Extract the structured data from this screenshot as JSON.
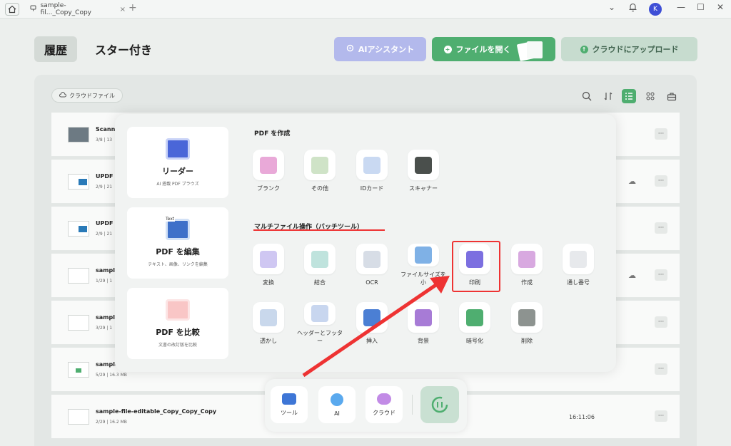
{
  "titlebar": {
    "tab_title": "sample-fil..._Copy_Copy",
    "avatar_letter": "K",
    "plus": "+",
    "close": "×",
    "minimize": "—",
    "maximize": "☐",
    "window_close": "✕",
    "chevron": "⌄",
    "bell": "🔔"
  },
  "nav": {
    "history": "履歴",
    "starred": "スター付き"
  },
  "header_buttons": {
    "ai": "AIアシスタント",
    "open": "ファイルを開く",
    "cloud_upload": "クラウドにアップロード"
  },
  "panel": {
    "cloud_files": "クラウドファイル"
  },
  "files": [
    {
      "name": "Scann",
      "meta": "3/8 | 13",
      "time": ""
    },
    {
      "name": "UPDF",
      "meta": "2/9 | 21",
      "time": ""
    },
    {
      "name": "UPDF",
      "meta": "2/9 | 21",
      "time": ""
    },
    {
      "name": "sample",
      "meta": "1/29 | 1",
      "time": ""
    },
    {
      "name": "sampl",
      "meta": "3/29 | 1",
      "time": ""
    },
    {
      "name": "sample",
      "meta": "5/29 | 16.3 MB",
      "time": ""
    },
    {
      "name": "sample-file-editable_Copy_Copy_Copy",
      "meta": "2/29 | 16.2 MB",
      "time": "16:11:06"
    }
  ],
  "popup": {
    "left_cards": [
      {
        "title": "リーダー",
        "sub": "AI 搭載 PDF ブラウズ"
      },
      {
        "title": "PDF を編集",
        "sub": "テキスト、画像、リンクを編集",
        "badge": "Text"
      },
      {
        "title": "PDF を比較",
        "sub": "文書の改訂版を比較"
      }
    ],
    "create_title": "PDF を作成",
    "create_tools": [
      "ブランク",
      "その他",
      "IDカード",
      "スキャナー"
    ],
    "batch_title": "マルチファイル操作（バッチツール）",
    "batch_row1": [
      "変換",
      "結合",
      "OCR",
      "ファイルサイズを小",
      "印刷",
      "作成",
      "通し番号"
    ],
    "batch_row2": [
      "透かし",
      "ヘッダーとフッター",
      "挿入",
      "背景",
      "暗号化",
      "削除"
    ]
  },
  "dock": {
    "tools": "ツール",
    "ai": "AI",
    "cloud": "クラウド"
  }
}
